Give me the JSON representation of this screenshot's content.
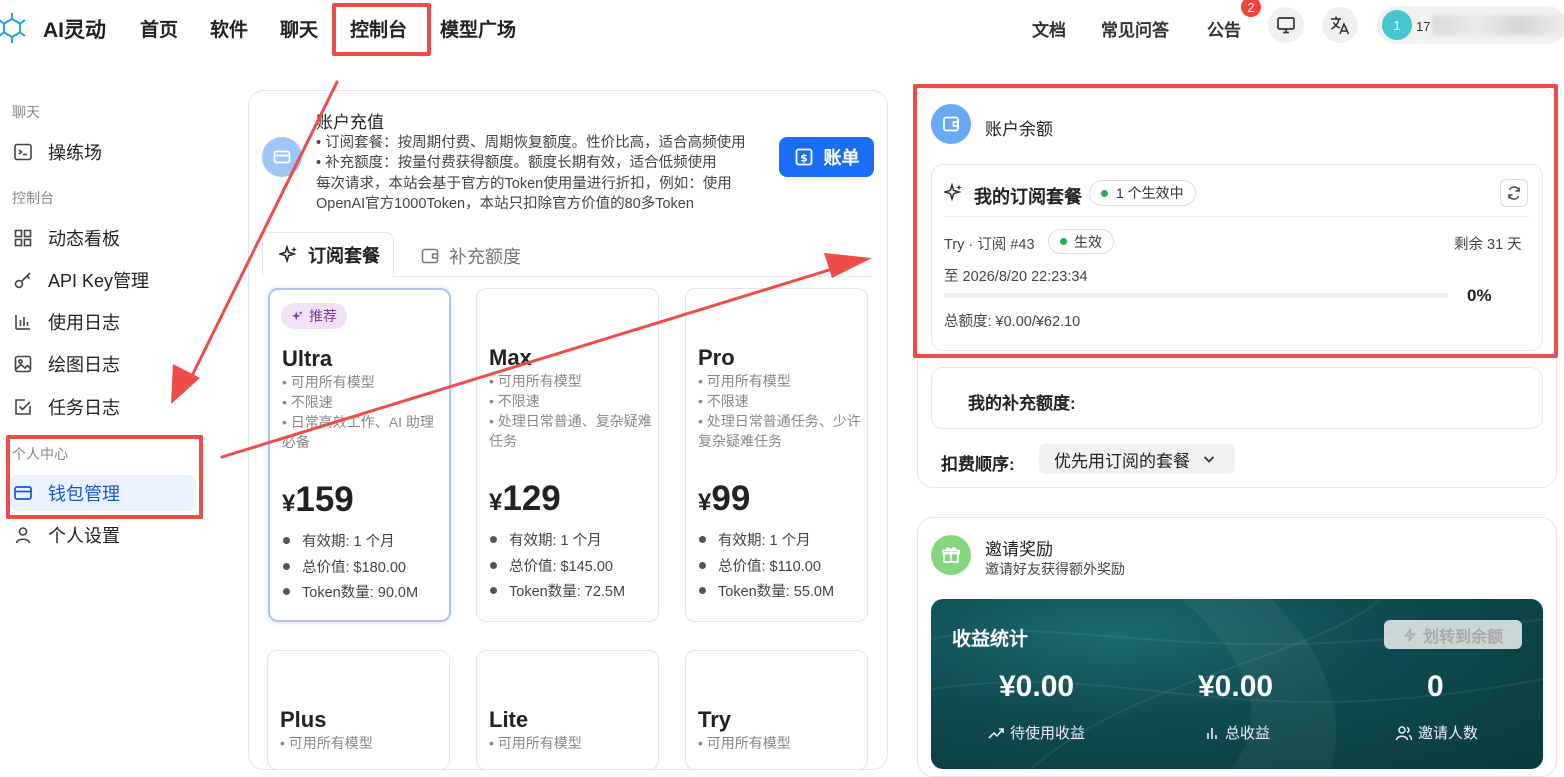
{
  "nav": {
    "brand": "AI灵动",
    "items": [
      "首页",
      "软件",
      "聊天",
      "控制台",
      "模型广场"
    ],
    "right": [
      "文档",
      "常见问答",
      "公告"
    ],
    "notification_count": "2",
    "user_avatar": "1",
    "user_name_prefix": "17"
  },
  "sidebar": {
    "section_chat": "聊天",
    "playground": "操练场",
    "section_console": "控制台",
    "dashboard": "动态看板",
    "api_keys": "API Key管理",
    "usage_logs": "使用日志",
    "drawing_logs": "绘图日志",
    "task_logs": "任务日志",
    "section_personal": "个人中心",
    "wallet": "钱包管理",
    "settings": "个人设置"
  },
  "recharge": {
    "title": "账户充值",
    "desc1": "• 订阅套餐：按周期付费、周期恢复额度。性价比高，适合高频使用",
    "desc2": "• 补充额度：按量付费获得额度。额度长期有效，适合低频使用",
    "desc3": "每次请求，本站会基于官方的Token使用量进行折扣，例如：使用",
    "desc4": "OpenAI官方1000Token，本站只扣除官方价值的80多Token",
    "bill_button": "账单",
    "tab_subscription": "订阅套餐",
    "tab_topup": "补充额度"
  },
  "plans": [
    {
      "badge": "推荐",
      "name": "Ultra",
      "features": [
        "• 可用所有模型",
        "• 不限速",
        "• 日常高效工作、AI 助理必备"
      ],
      "currency": "¥",
      "price": "159",
      "validity": "有效期: 1 个月",
      "total": "总价值: $180.00",
      "tokens": "Token数量: 90.0M"
    },
    {
      "name": "Max",
      "features": [
        "• 可用所有模型",
        "• 不限速",
        "• 处理日常普通、复杂疑难任务"
      ],
      "currency": "¥",
      "price": "129",
      "validity": "有效期: 1 个月",
      "total": "总价值: $145.00",
      "tokens": "Token数量: 72.5M"
    },
    {
      "name": "Pro",
      "features": [
        "• 可用所有模型",
        "• 不限速",
        "• 处理日常普通任务、少许复杂疑难任务"
      ],
      "currency": "¥",
      "price": "99",
      "validity": "有效期: 1 个月",
      "total": "总价值: $110.00",
      "tokens": "Token数量: 55.0M"
    },
    {
      "name": "Plus",
      "features": [
        "• 可用所有模型"
      ]
    },
    {
      "name": "Lite",
      "features": [
        "• 可用所有模型"
      ]
    },
    {
      "name": "Try",
      "features": [
        "• 可用所有模型"
      ]
    }
  ],
  "balance": {
    "title": "账户余额",
    "my_subscription": "我的订阅套餐",
    "active_count": "1 个生效中",
    "sub_label": "Try · 订阅 #43",
    "status": "生效",
    "remaining": "剩余 31 天",
    "until": "至 2026/8/20 22:23:34",
    "progress_percent": 0,
    "progress_text": "0%",
    "quota": "总额度: ¥0.00/¥62.10",
    "my_topup": "我的补充额度:",
    "order_label": "扣费顺序:",
    "order_value": "优先用订阅的套餐"
  },
  "invite": {
    "title": "邀请奖励",
    "subtitle": "邀请好友获得额外奖励",
    "stats_title": "收益统计",
    "transfer_button": "划转到余额",
    "pending_value": "¥0.00",
    "pending_label": "待使用收益",
    "total_value": "¥0.00",
    "total_label": "总收益",
    "invites_value": "0",
    "invites_label": "邀请人数"
  },
  "colors": {
    "accent": "#1a6ef5",
    "annotation": "#ee4b4b",
    "success": "#22b04b",
    "stats_bg": "#0f4a4f"
  }
}
